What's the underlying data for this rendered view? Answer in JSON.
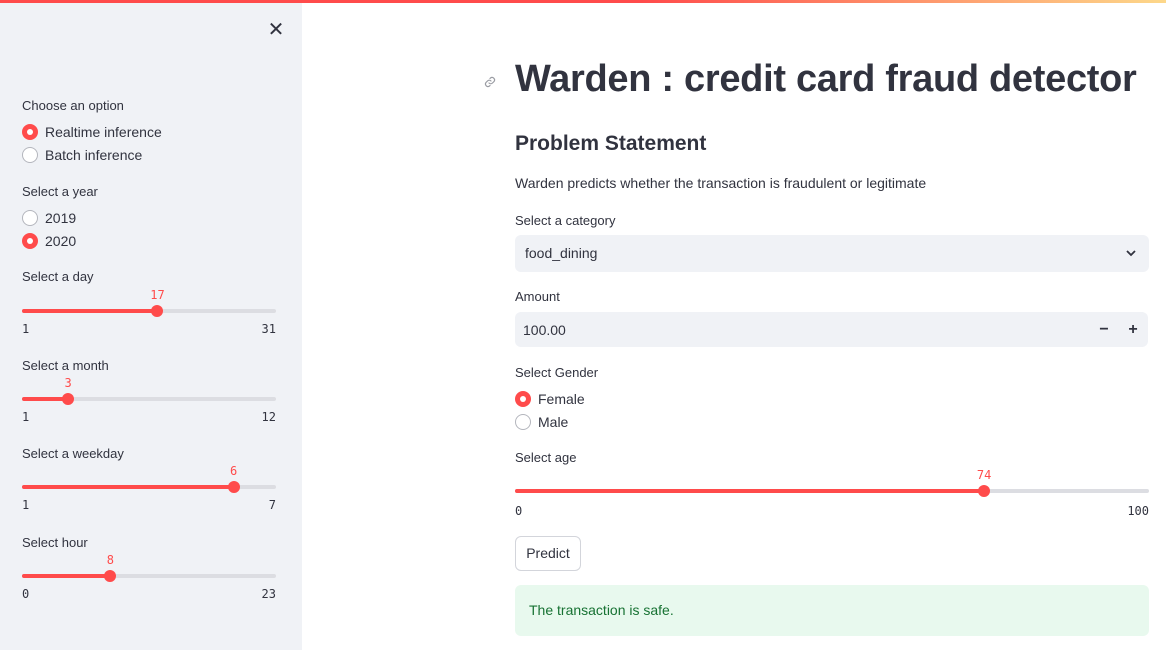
{
  "colors": {
    "accent": "#ff4b4b",
    "sidebar_bg": "#f0f2f6",
    "success_bg": "#e8f9ee",
    "success_text": "#177233"
  },
  "sidebar": {
    "close_icon": "close-icon",
    "option": {
      "label": "Choose an option",
      "choices": [
        "Realtime inference",
        "Batch inference"
      ],
      "selected": "Realtime inference"
    },
    "year": {
      "label": "Select a year",
      "choices": [
        "2019",
        "2020"
      ],
      "selected": "2020"
    },
    "day": {
      "label": "Select a day",
      "value": "17",
      "min": "1",
      "max": "31"
    },
    "month": {
      "label": "Select a month",
      "value": "3",
      "min": "1",
      "max": "12"
    },
    "weekday": {
      "label": "Select a weekday",
      "value": "6",
      "min": "1",
      "max": "7"
    },
    "hour": {
      "label": "Select hour",
      "value": "8",
      "min": "0",
      "max": "23"
    }
  },
  "main": {
    "title": "Warden : credit card fraud detector",
    "subtitle": "Problem Statement",
    "description": "Warden predicts whether the transaction is fraudulent or legitimate",
    "category": {
      "label": "Select a category",
      "value": "food_dining"
    },
    "amount": {
      "label": "Amount",
      "value": "100.00",
      "minus": "−",
      "plus": "+"
    },
    "gender": {
      "label": "Select Gender",
      "choices": [
        "Female",
        "Male"
      ],
      "selected": "Female"
    },
    "age": {
      "label": "Select age",
      "value": "74",
      "min": "0",
      "max": "100"
    },
    "predict_label": "Predict",
    "result": "The transaction is safe."
  }
}
